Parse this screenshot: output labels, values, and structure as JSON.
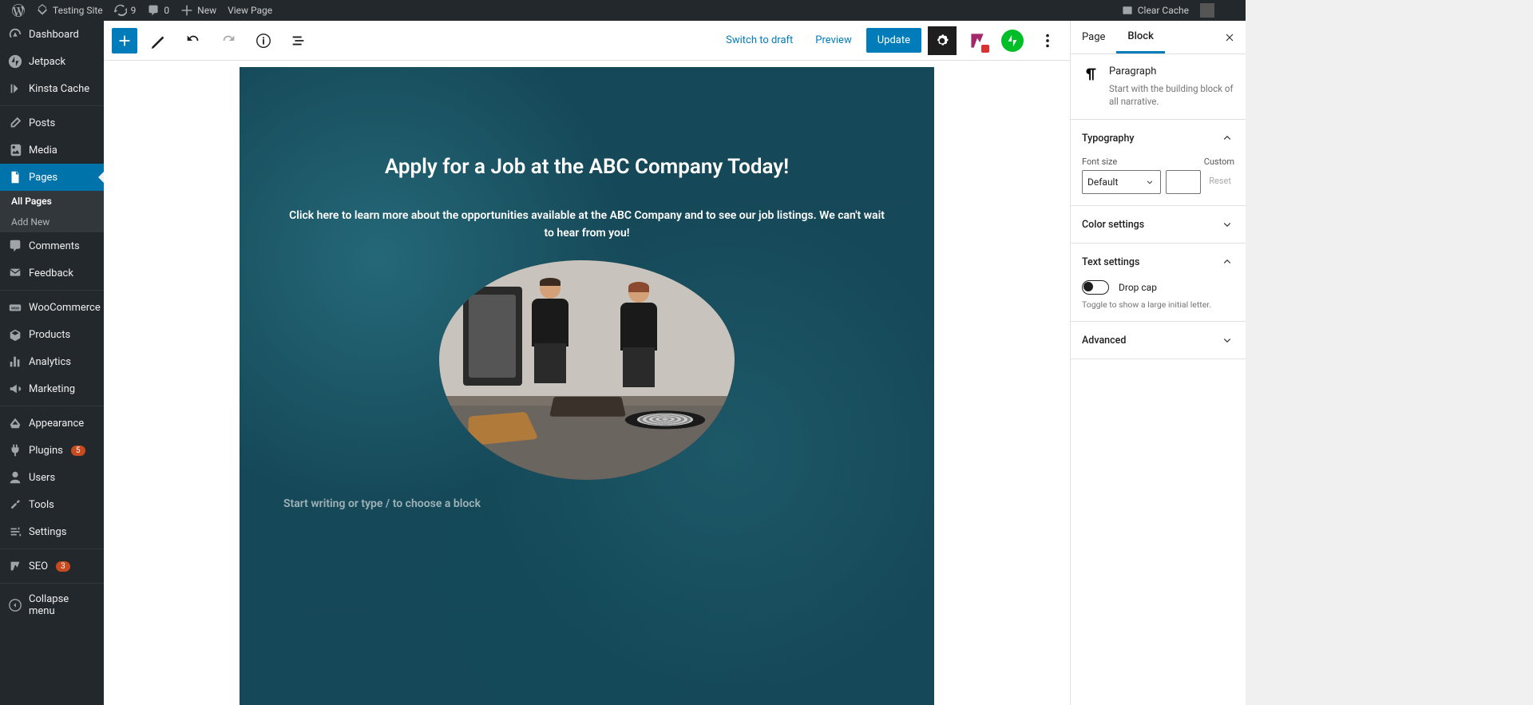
{
  "adminBar": {
    "site": "Testing Site",
    "updates": "9",
    "comments": "0",
    "new": "New",
    "viewPage": "View Page",
    "clearCache": "Clear Cache"
  },
  "menu": {
    "dashboard": "Dashboard",
    "jetpack": "Jetpack",
    "kinsta": "Kinsta Cache",
    "posts": "Posts",
    "media": "Media",
    "pages": "Pages",
    "allPages": "All Pages",
    "addNew": "Add New",
    "commentsM": "Comments",
    "feedback": "Feedback",
    "woo": "WooCommerce",
    "products": "Products",
    "analytics": "Analytics",
    "marketing": "Marketing",
    "appearance": "Appearance",
    "plugins": "Plugins",
    "pluginsBadge": "5",
    "users": "Users",
    "tools": "Tools",
    "settingsM": "Settings",
    "seo": "SEO",
    "seoBadge": "3",
    "collapse": "Collapse menu"
  },
  "header": {
    "switchDraft": "Switch to draft",
    "preview": "Preview",
    "update": "Update"
  },
  "content": {
    "heading": "Apply for a Job at the ABC Company Today!",
    "paragraph": "Click here to learn more about the opportunities available at the ABC Company and to see our job listings. We can't wait to hear from you!",
    "placeholder": "Start writing or type / to choose a block"
  },
  "sidebar": {
    "tabPage": "Page",
    "tabBlock": "Block",
    "blockName": "Paragraph",
    "blockDesc": "Start with the building block of all narrative.",
    "typography": "Typography",
    "fontSize": "Font size",
    "custom": "Custom",
    "default": "Default",
    "reset": "Reset",
    "colorSettings": "Color settings",
    "textSettings": "Text settings",
    "dropCap": "Drop cap",
    "dropCapHelp": "Toggle to show a large initial letter.",
    "advanced": "Advanced"
  }
}
